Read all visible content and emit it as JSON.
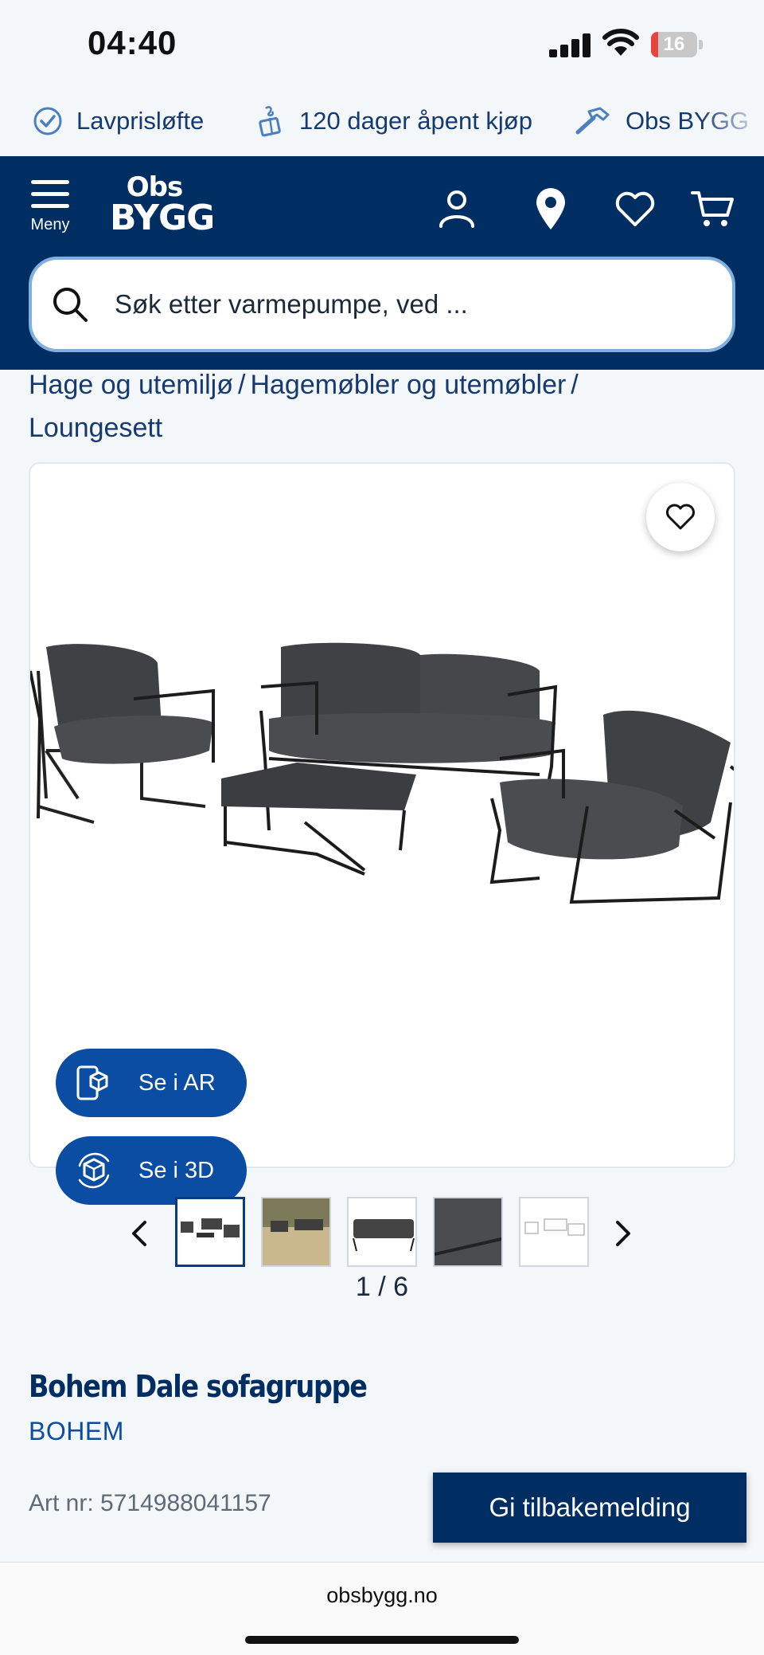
{
  "status_bar": {
    "time": "04:40",
    "battery": "16",
    "battery_level_percent": 16
  },
  "usp": [
    {
      "icon": "check-circle-icon",
      "label": "Lavprisløfte"
    },
    {
      "icon": "gift-box-icon",
      "label": "120 dager åpent kjøp"
    },
    {
      "icon": "hammer-icon",
      "label": "Obs BYGG"
    }
  ],
  "header": {
    "menu_label": "Meny",
    "logo_top": "Obs",
    "logo_bottom": "BYGG",
    "icons": [
      "user-icon",
      "location-pin-icon",
      "heart-icon",
      "cart-icon"
    ],
    "search_placeholder": "Søk etter varmepumpe, ved ..."
  },
  "breadcrumb": {
    "items": [
      "Hage og utemiljø",
      "Hagemøbler og utemøbler",
      "Loungesett"
    ],
    "separator": "/"
  },
  "gallery": {
    "ar_label": "Se i AR",
    "three_d_label": "Se i 3D",
    "counter": "1 / 6",
    "current_index": 1,
    "total": 6
  },
  "product": {
    "title": "Bohem Dale sofagruppe",
    "brand": "BOHEM",
    "art_nr": "Art nr: 5714988041157"
  },
  "feedback_label": "Gi tilbakemelding",
  "browser": {
    "url": "obsbygg.no"
  },
  "colors": {
    "brand_navy": "#002d62",
    "accent_blue": "#0a4da3",
    "background": "#f4f7fa"
  }
}
